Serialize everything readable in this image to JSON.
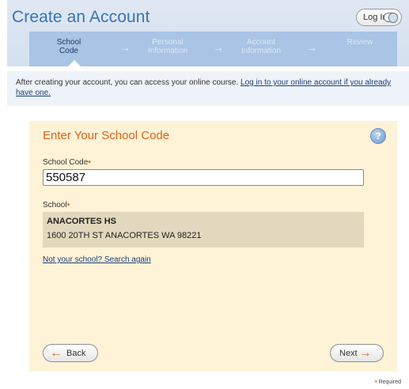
{
  "header": {
    "title": "Create an Account",
    "login_label": "Log In"
  },
  "steps": [
    {
      "line1": "School",
      "line2": "Code",
      "active": true
    },
    {
      "line1": "Personal",
      "line2": "Information",
      "active": false
    },
    {
      "line1": "Account",
      "line2": "Information",
      "active": false
    },
    {
      "line1": "Review",
      "line2": "",
      "active": false
    }
  ],
  "intro": {
    "text": "After creating your account, you can access your online course.",
    "link": "Log in to your online account if you already have one."
  },
  "form": {
    "title": "Enter Your School Code",
    "school_code_label": "School Code",
    "school_code_value": "550587",
    "school_label": "School",
    "school_name": "ANACORTES HS",
    "school_address": "1600 20TH ST ANACORTES WA 98221",
    "search_again": "Not your school? Search again",
    "back_label": "Back",
    "next_label": "Next",
    "help_glyph": "?"
  },
  "footer": {
    "required_label": "Required"
  },
  "colors": {
    "title_blue": "#3a73b5",
    "accent_orange": "#e0621a",
    "card_bg": "#fef3d6",
    "steps_bg": "#a9c4e4"
  }
}
